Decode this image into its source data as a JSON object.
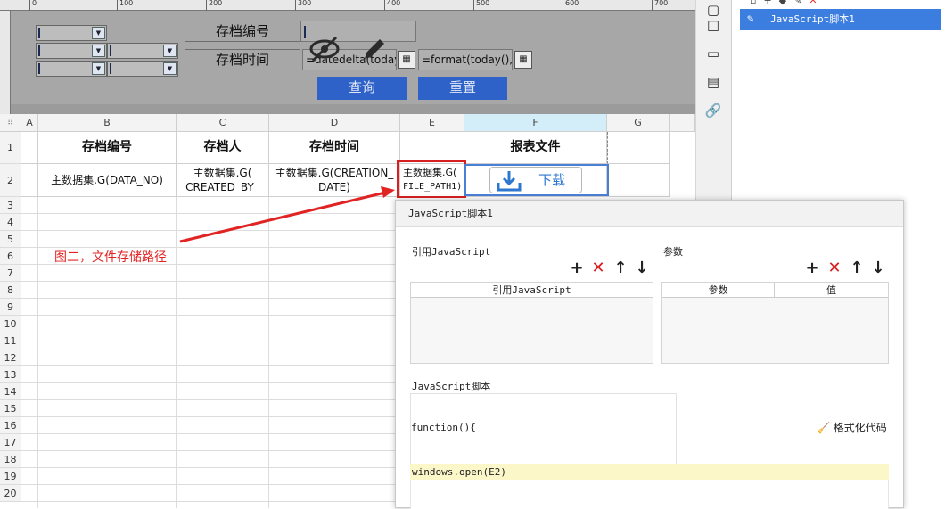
{
  "designer": {
    "ruler_labels": [
      "0",
      "100",
      "200",
      "300",
      "400",
      "500",
      "600",
      "700"
    ],
    "label_archive_no": "存档编号",
    "label_archive_time": "存档时间",
    "date_from_formula": "=datedelta(today(),",
    "date_to_formula": "=format(today(),\"yy",
    "query_button": "查询",
    "reset_button": "重置"
  },
  "sheet": {
    "columns": [
      "A",
      "B",
      "C",
      "D",
      "E",
      "F",
      "G"
    ],
    "rows": [
      "1",
      "2",
      "3",
      "4",
      "5",
      "6",
      "7",
      "8",
      "9",
      "10",
      "11",
      "12",
      "13",
      "14",
      "15",
      "16",
      "17",
      "18",
      "19",
      "20"
    ],
    "header_row": {
      "B": "存档编号",
      "C": "存档人",
      "D": "存档时间",
      "E": "",
      "F": "报表文件"
    },
    "data_row": {
      "B": "主数据集.G(DATA_NO)",
      "C_line1": "主数据集.G(",
      "C_line2": "CREATED_BY_",
      "D_line1": "主数据集.G(CREATION_",
      "D_line2": "DATE)",
      "E_line1": "主数据集.G(",
      "E_line2": "FILE_PATH1)",
      "F": "下载"
    },
    "annotation": "图二，文件存储路径"
  },
  "widget_panel": {
    "item": "JavaScript脚本1"
  },
  "js_dialog": {
    "title": "JavaScript脚本1",
    "ref_js_section": "引用JavaScript",
    "params_section": "参数",
    "ref_js_column": "引用JavaScript",
    "param_column": "参数",
    "value_column": "值",
    "script_section": "JavaScript脚本",
    "function_header": "function(){",
    "code": "windows.open(E2)",
    "format_button": "格式化代码"
  },
  "colors": {
    "accent_blue": "#2e62c9",
    "highlight_red": "#e02424",
    "selection_blue": "#3c7ee0"
  }
}
